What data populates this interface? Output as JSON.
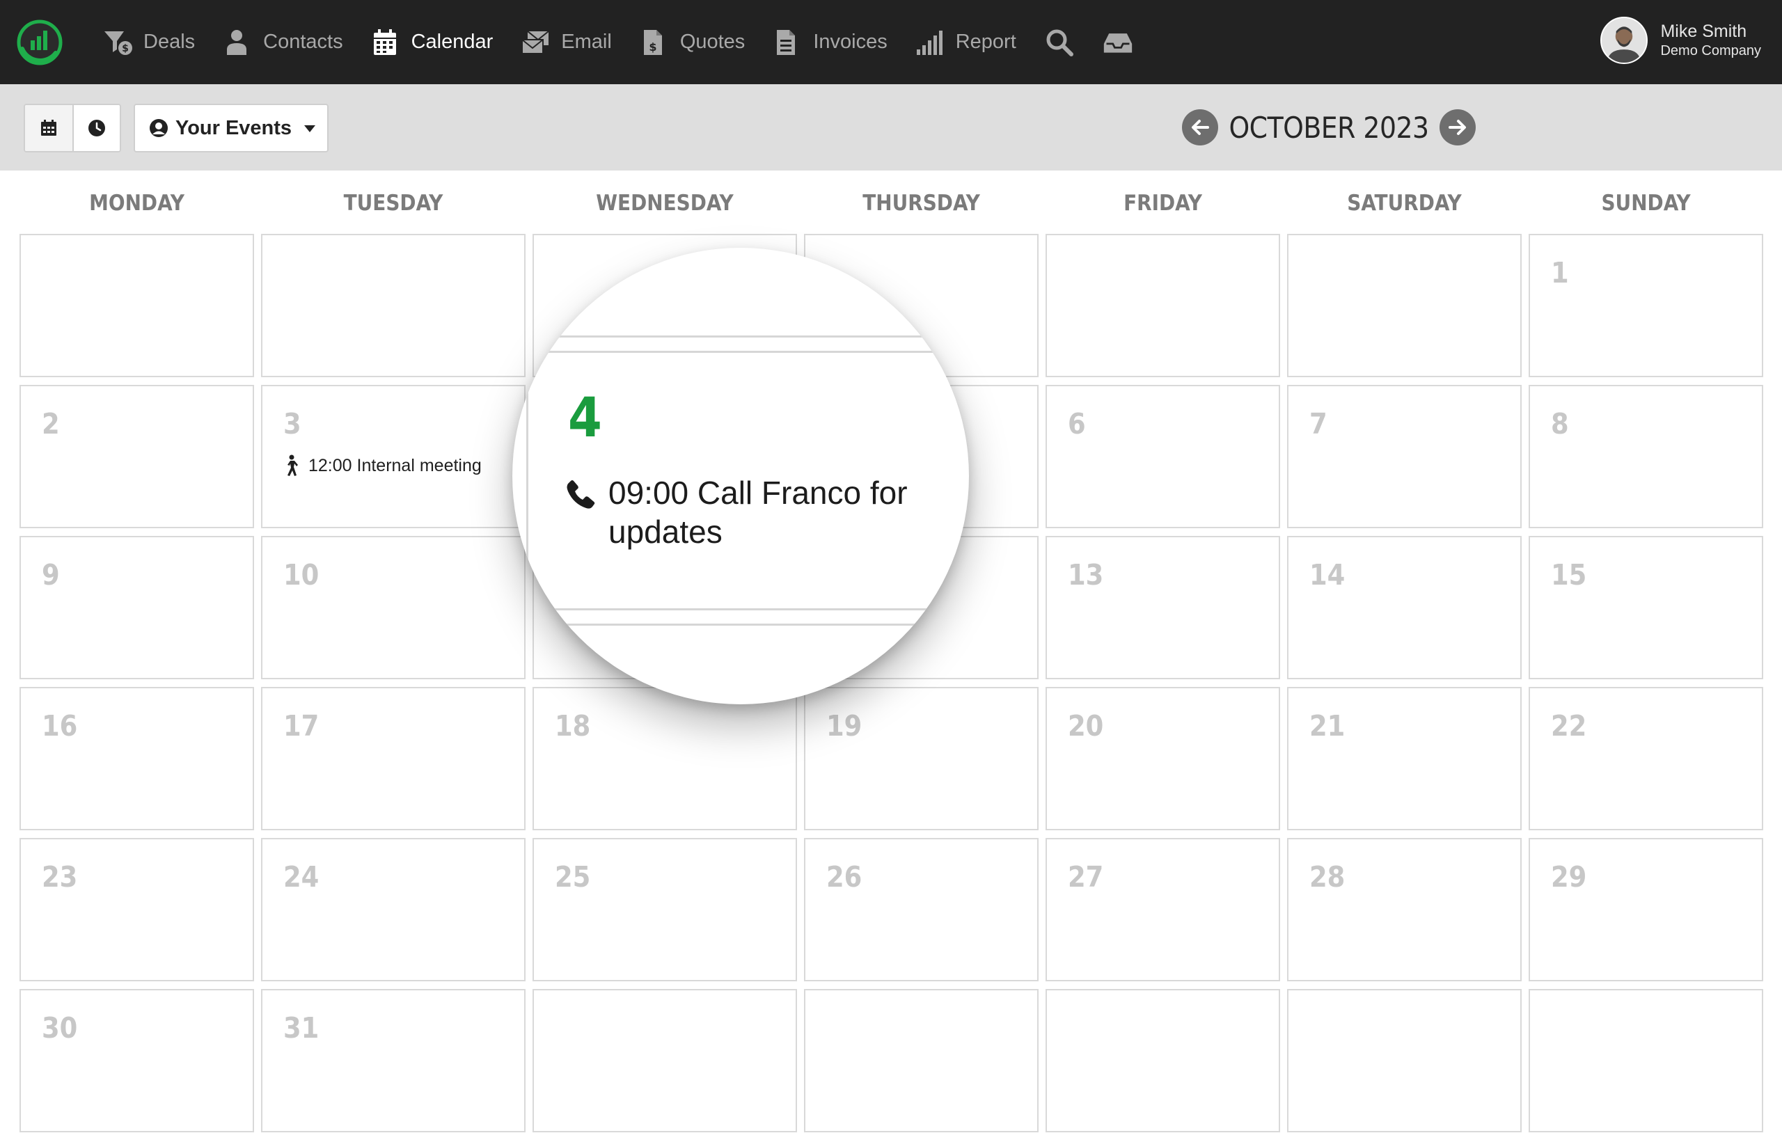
{
  "nav": {
    "items": [
      {
        "label": "Deals",
        "icon": "deals-funnel-icon",
        "active": false
      },
      {
        "label": "Contacts",
        "icon": "person-icon",
        "active": false
      },
      {
        "label": "Calendar",
        "icon": "calendar-icon",
        "active": true
      },
      {
        "label": "Email",
        "icon": "email-icon",
        "active": false
      },
      {
        "label": "Quotes",
        "icon": "quote-document-icon",
        "active": false
      },
      {
        "label": "Invoices",
        "icon": "invoice-document-icon",
        "active": false
      },
      {
        "label": "Report",
        "icon": "bar-chart-icon",
        "active": false
      }
    ],
    "search_icon": "search-icon",
    "inbox_icon": "inbox-tray-icon"
  },
  "user": {
    "name": "Mike Smith",
    "company": "Demo Company"
  },
  "toolbar": {
    "events_filter": "Your Events",
    "month_title": "OCTOBER 2023"
  },
  "calendar": {
    "weekdays": [
      "MONDAY",
      "TUESDAY",
      "WEDNESDAY",
      "THURSDAY",
      "FRIDAY",
      "SATURDAY",
      "SUNDAY"
    ],
    "cells": [
      "",
      "",
      "",
      "",
      "",
      "",
      "1",
      "2",
      "3",
      "",
      "",
      "6",
      "7",
      "8",
      "9",
      "10",
      "",
      "",
      "13",
      "14",
      "15",
      "16",
      "17",
      "18",
      "19",
      "20",
      "21",
      "22",
      "23",
      "24",
      "25",
      "26",
      "27",
      "28",
      "29",
      "30",
      "31",
      "",
      "",
      "",
      "",
      ""
    ],
    "events": [
      {
        "day": "3",
        "time": "12:00",
        "title": "Internal meeting",
        "text": "12:00 Internal meeting",
        "icon": "walking-person-icon"
      }
    ]
  },
  "magnifier": {
    "day": "4",
    "event_text": "09:00 Call Franco for updates",
    "event_icon": "phone-icon",
    "day_color": "#1a9c3e"
  },
  "colors": {
    "topbar": "#222222",
    "toolbar": "#dedede",
    "accent_green": "#1a9c3e"
  }
}
